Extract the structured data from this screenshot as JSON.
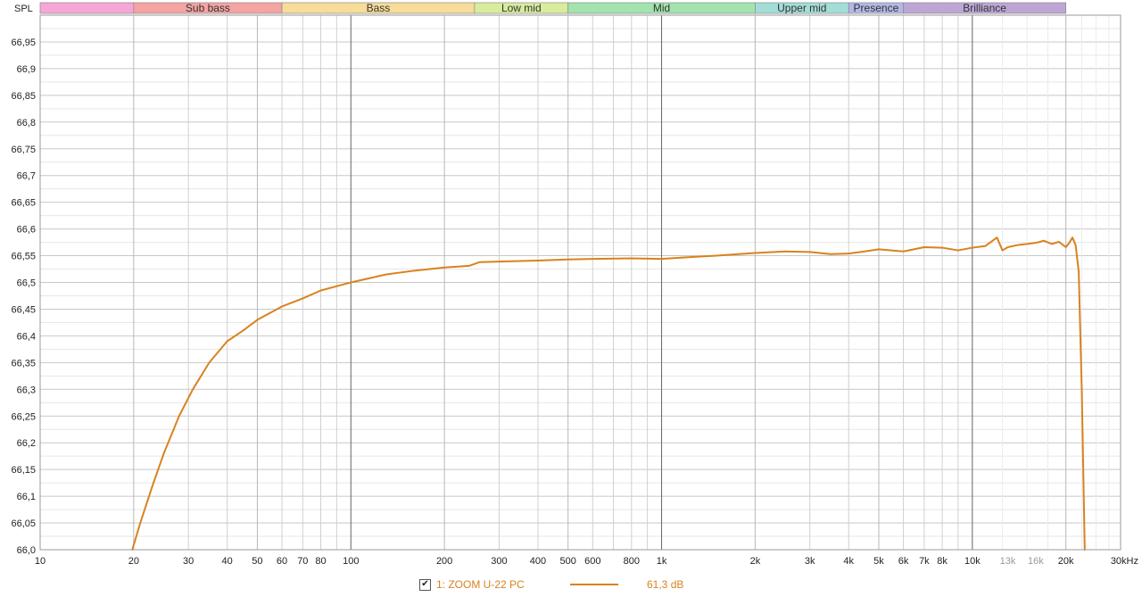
{
  "app": {
    "corner_label": "SPL",
    "legend": {
      "checkbox_checked": true,
      "checkbox_glyph": "✔",
      "name": "1: ZOOM U-22 PC",
      "value": "61,3 dB",
      "color": "#d9821f"
    }
  },
  "chart_data": {
    "type": "line",
    "x_scale": "log",
    "xlim": [
      10,
      30000
    ],
    "ylim": [
      66.0,
      67.0
    ],
    "y_ticks": [
      {
        "value": 66.0,
        "label": "66,0"
      },
      {
        "value": 66.05,
        "label": "66,05"
      },
      {
        "value": 66.1,
        "label": "66,1"
      },
      {
        "value": 66.15,
        "label": "66,15"
      },
      {
        "value": 66.2,
        "label": "66,2"
      },
      {
        "value": 66.25,
        "label": "66,25"
      },
      {
        "value": 66.3,
        "label": "66,3"
      },
      {
        "value": 66.35,
        "label": "66,35"
      },
      {
        "value": 66.4,
        "label": "66,4"
      },
      {
        "value": 66.45,
        "label": "66,45"
      },
      {
        "value": 66.5,
        "label": "66,5"
      },
      {
        "value": 66.55,
        "label": "66,55"
      },
      {
        "value": 66.6,
        "label": "66,6"
      },
      {
        "value": 66.65,
        "label": "66,65"
      },
      {
        "value": 66.7,
        "label": "66,7"
      },
      {
        "value": 66.75,
        "label": "66,75"
      },
      {
        "value": 66.8,
        "label": "66,8"
      },
      {
        "value": 66.85,
        "label": "66,85"
      },
      {
        "value": 66.9,
        "label": "66,9"
      },
      {
        "value": 66.95,
        "label": "66,95"
      }
    ],
    "x_ticks": [
      {
        "value": 10,
        "label": "10"
      },
      {
        "value": 20,
        "label": "20"
      },
      {
        "value": 30,
        "label": "30"
      },
      {
        "value": 40,
        "label": "40"
      },
      {
        "value": 50,
        "label": "50"
      },
      {
        "value": 60,
        "label": "60"
      },
      {
        "value": 70,
        "label": "70"
      },
      {
        "value": 80,
        "label": "80"
      },
      {
        "value": 100,
        "label": "100"
      },
      {
        "value": 200,
        "label": "200"
      },
      {
        "value": 300,
        "label": "300"
      },
      {
        "value": 400,
        "label": "400"
      },
      {
        "value": 500,
        "label": "500"
      },
      {
        "value": 600,
        "label": "600"
      },
      {
        "value": 800,
        "label": "800"
      },
      {
        "value": 1000,
        "label": "1k"
      },
      {
        "value": 2000,
        "label": "2k"
      },
      {
        "value": 3000,
        "label": "3k"
      },
      {
        "value": 4000,
        "label": "4k"
      },
      {
        "value": 5000,
        "label": "5k"
      },
      {
        "value": 6000,
        "label": "6k"
      },
      {
        "value": 7000,
        "label": "7k"
      },
      {
        "value": 8000,
        "label": "8k"
      },
      {
        "value": 10000,
        "label": "10k"
      },
      {
        "value": 13000,
        "label": "13k",
        "minor": true
      },
      {
        "value": 16000,
        "label": "16k",
        "minor": true
      },
      {
        "value": 20000,
        "label": "20k"
      },
      {
        "value": 30000,
        "label": "30kHz"
      }
    ],
    "grid": true,
    "bands": [
      {
        "label": "",
        "from": 10,
        "to": 20,
        "color": "#f7a6d8"
      },
      {
        "label": "Sub bass",
        "from": 20,
        "to": 60,
        "color": "#f5a3a3"
      },
      {
        "label": "Bass",
        "from": 60,
        "to": 250,
        "color": "#f7dc9a"
      },
      {
        "label": "Low mid",
        "from": 250,
        "to": 500,
        "color": "#d8ec9e"
      },
      {
        "label": "Mid",
        "from": 500,
        "to": 2000,
        "color": "#a3e3ad"
      },
      {
        "label": "Upper mid",
        "from": 2000,
        "to": 4000,
        "color": "#a3ddd8"
      },
      {
        "label": "Presence",
        "from": 4000,
        "to": 6000,
        "color": "#b3b8e6"
      },
      {
        "label": "Brilliance",
        "from": 6000,
        "to": 20000,
        "color": "#bda6d6"
      }
    ],
    "series": [
      {
        "name": "1: ZOOM U-22 PC",
        "color": "#d9821f",
        "points": [
          [
            19.8,
            66.0
          ],
          [
            21,
            66.05
          ],
          [
            23,
            66.12
          ],
          [
            25,
            66.18
          ],
          [
            28,
            66.25
          ],
          [
            31,
            66.3
          ],
          [
            35,
            66.35
          ],
          [
            40,
            66.39
          ],
          [
            45,
            66.41
          ],
          [
            50,
            66.43
          ],
          [
            60,
            66.455
          ],
          [
            70,
            66.47
          ],
          [
            80,
            66.485
          ],
          [
            100,
            66.5
          ],
          [
            130,
            66.515
          ],
          [
            160,
            66.522
          ],
          [
            200,
            66.528
          ],
          [
            240,
            66.531
          ],
          [
            260,
            66.538
          ],
          [
            300,
            66.539
          ],
          [
            400,
            66.541
          ],
          [
            500,
            66.543
          ],
          [
            600,
            66.544
          ],
          [
            800,
            66.545
          ],
          [
            1000,
            66.544
          ],
          [
            1200,
            66.547
          ],
          [
            1500,
            66.55
          ],
          [
            2000,
            66.555
          ],
          [
            2500,
            66.558
          ],
          [
            3000,
            66.557
          ],
          [
            3500,
            66.553
          ],
          [
            4000,
            66.554
          ],
          [
            4500,
            66.558
          ],
          [
            5000,
            66.562
          ],
          [
            6000,
            66.558
          ],
          [
            7000,
            66.566
          ],
          [
            8000,
            66.565
          ],
          [
            9000,
            66.56
          ],
          [
            10000,
            66.565
          ],
          [
            11000,
            66.568
          ],
          [
            12000,
            66.584
          ],
          [
            12500,
            66.56
          ],
          [
            13000,
            66.566
          ],
          [
            14000,
            66.57
          ],
          [
            15000,
            66.572
          ],
          [
            16000,
            66.574
          ],
          [
            17000,
            66.578
          ],
          [
            18000,
            66.572
          ],
          [
            19000,
            66.576
          ],
          [
            20000,
            66.566
          ],
          [
            20500,
            66.574
          ],
          [
            21000,
            66.584
          ],
          [
            21500,
            66.57
          ],
          [
            22000,
            66.52
          ],
          [
            22500,
            66.3
          ],
          [
            23000,
            66.0
          ]
        ]
      }
    ]
  }
}
